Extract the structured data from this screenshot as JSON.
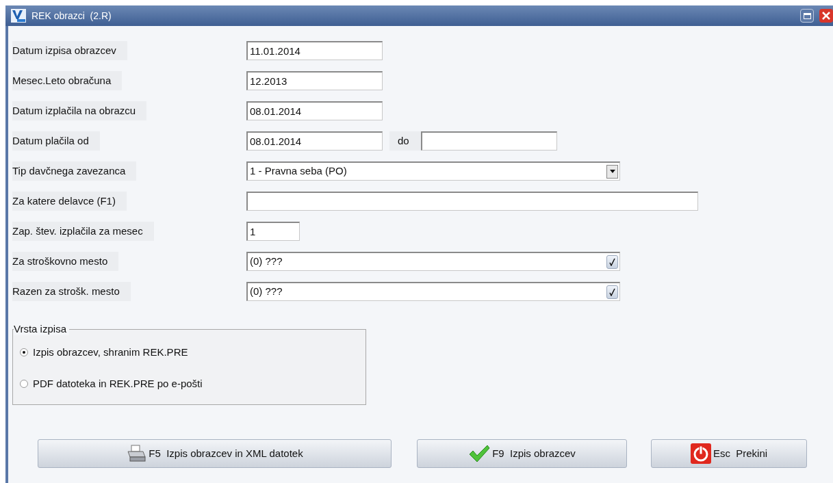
{
  "window": {
    "title": "REK obrazci  (2.R)"
  },
  "fields": [
    {
      "kind": "medium",
      "label": "Datum izpisa obrazcev",
      "value": "11.01.2014"
    },
    {
      "kind": "medium",
      "label": "Mesec.Leto obračuna",
      "value": "12.2013"
    },
    {
      "kind": "medium",
      "label": "Datum izplačila na obrazcu",
      "value": "08.01.2014"
    },
    {
      "kind": "range",
      "label": "Datum plačila od",
      "value": "08.01.2014",
      "to_label": "do"
    },
    {
      "kind": "select",
      "label": "Tip davčnega zavezanca",
      "value": "1 - Pravna seba (PO)"
    },
    {
      "kind": "long",
      "label": "Za katere delavce (F1)"
    },
    {
      "kind": "short",
      "label": "Zap. štev. izplačila za mesec",
      "value": "1"
    },
    {
      "kind": "lookup",
      "label": "Za stroškovno mesto",
      "value": "(0) ???"
    },
    {
      "kind": "lookup",
      "label": "Razen za strošk. mesto",
      "value": "(0) ???"
    }
  ],
  "output_type": {
    "title": "Vrsta izpisa",
    "options": [
      {
        "label": "Izpis obrazcev, shranim REK.PRE",
        "selected": true
      },
      {
        "label": "PDF datoteka in REK.PRE po e-pošti",
        "selected": false
      }
    ]
  },
  "buttons": [
    {
      "kind": "print",
      "label": "F5  Izpis obrazcev in XML datotek"
    },
    {
      "kind": "ok",
      "label": "F9  Izpis obrazcev"
    },
    {
      "kind": "cancel",
      "label": "Esc  Prekini"
    }
  ]
}
